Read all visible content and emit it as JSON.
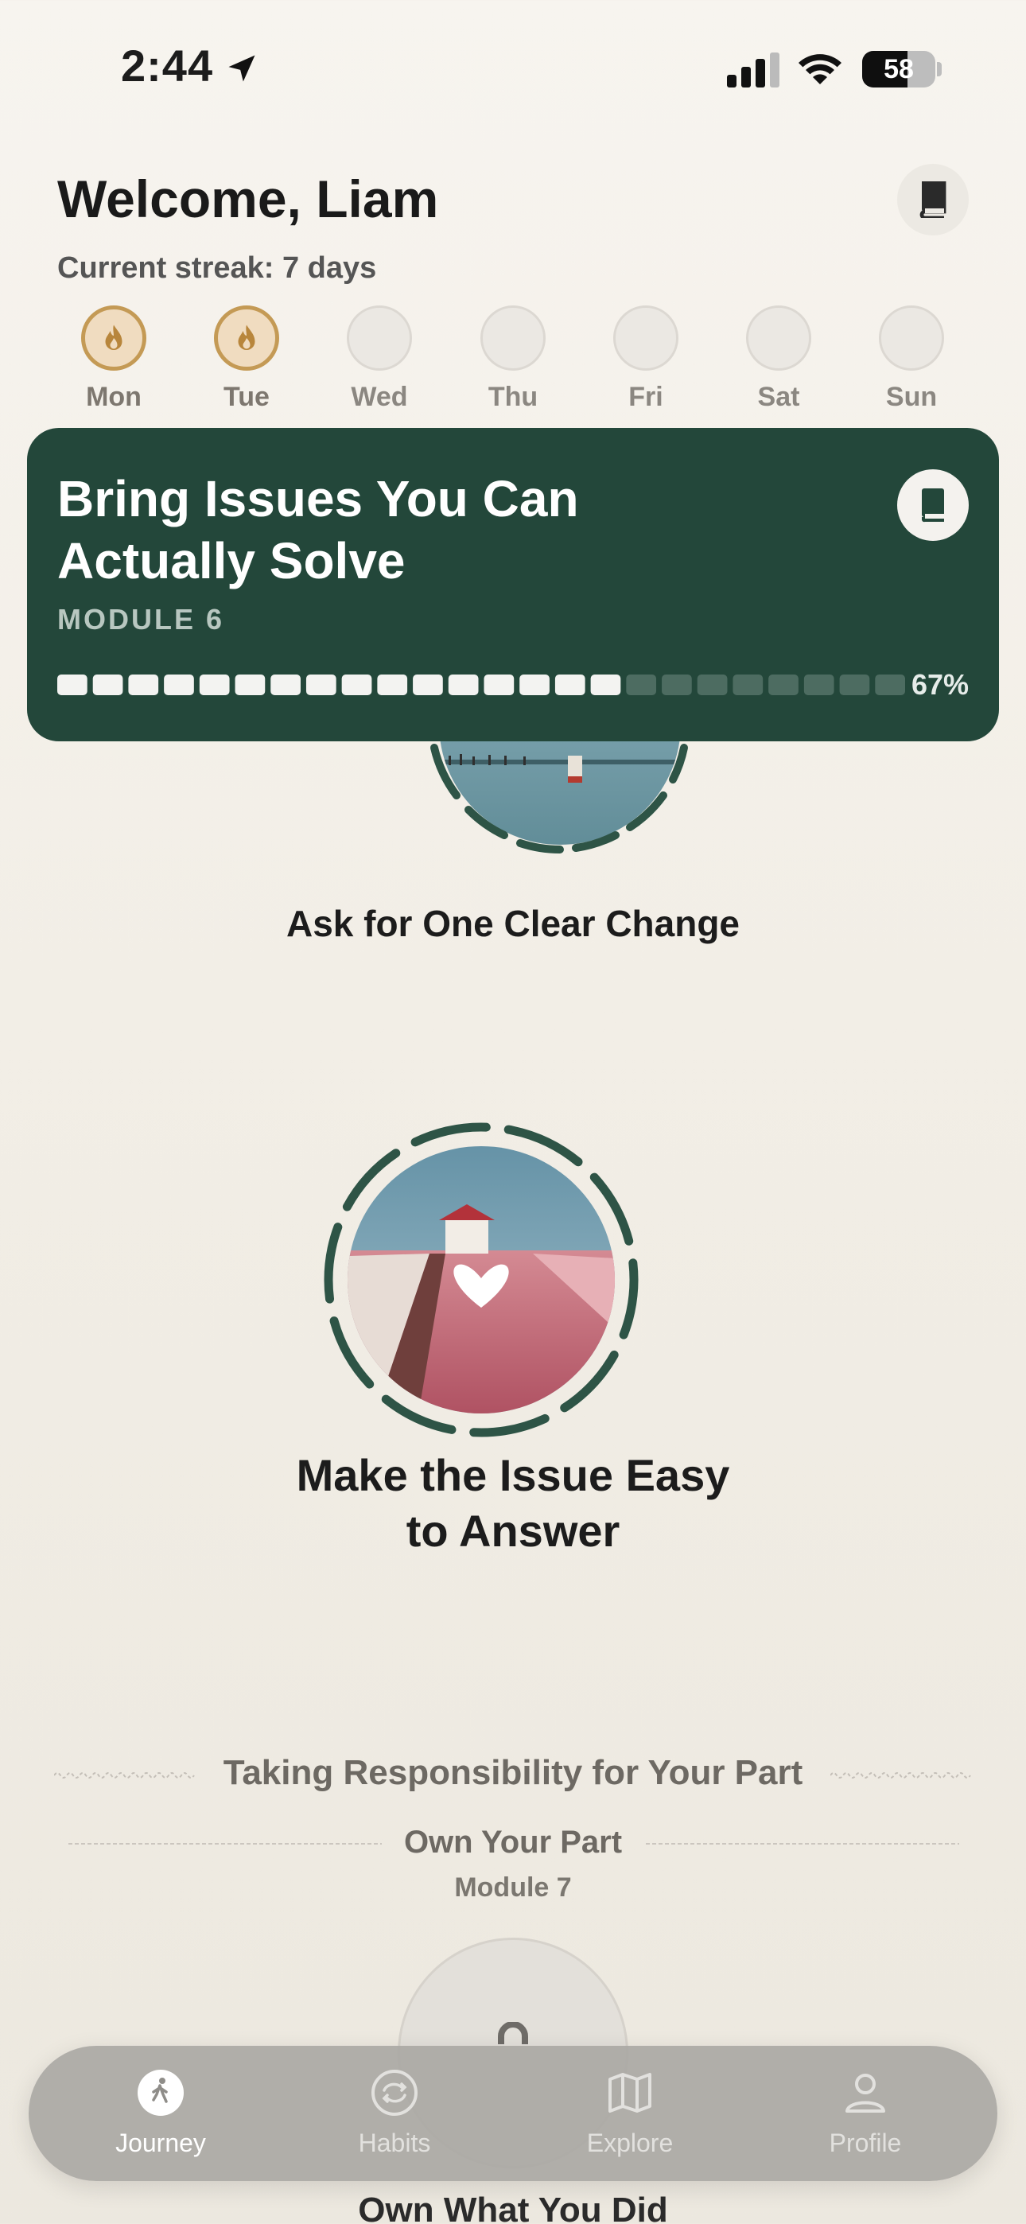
{
  "status_bar": {
    "time": "2:44",
    "battery": "58"
  },
  "header": {
    "welcome": "Welcome, Liam",
    "streak": "Current streak: 7 days"
  },
  "week": [
    {
      "label": "Mon",
      "completed": true
    },
    {
      "label": "Tue",
      "completed": true
    },
    {
      "label": "Wed",
      "completed": false
    },
    {
      "label": "Thu",
      "completed": false
    },
    {
      "label": "Fri",
      "completed": false
    },
    {
      "label": "Sat",
      "completed": false
    },
    {
      "label": "Sun",
      "completed": false
    }
  ],
  "module_card": {
    "title": "Bring Issues You Can Actually Solve",
    "module": "MODULE 6",
    "progress_percent": "67%",
    "progress_fraction": 0.67
  },
  "lessons": [
    {
      "title": "Ask for One Clear Change"
    },
    {
      "title_line1": "Make the Issue Easy",
      "title_line2": "to Answer"
    }
  ],
  "next_section": {
    "title": "Taking Responsibility for Your Part",
    "module_title": "Own Your Part",
    "module_label": "Module 7",
    "lesson_title": "Own What You Did"
  },
  "tabbar": {
    "tabs": [
      {
        "label": "Journey",
        "icon": "walking-person-icon",
        "active": true
      },
      {
        "label": "Habits",
        "icon": "repeat-icon",
        "active": false
      },
      {
        "label": "Explore",
        "icon": "map-icon",
        "active": false
      },
      {
        "label": "Profile",
        "icon": "person-icon",
        "active": false
      }
    ]
  },
  "colors": {
    "card": "#23473a",
    "streak_gold": "#c49a55",
    "ring": "#2e5446"
  }
}
